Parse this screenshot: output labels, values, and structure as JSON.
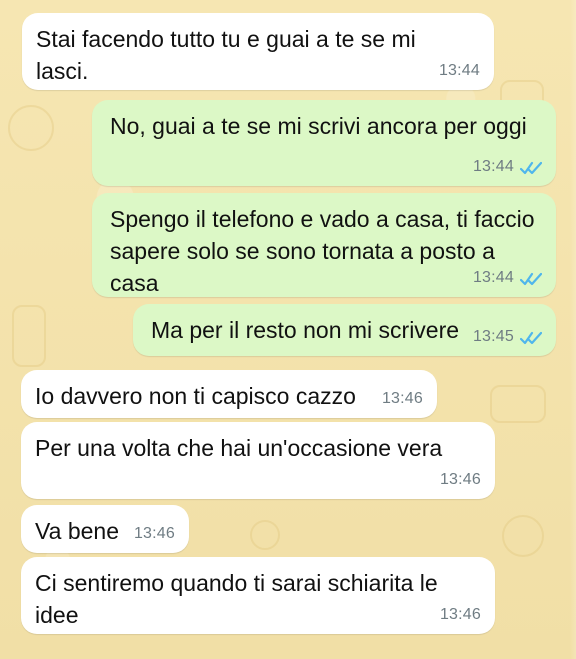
{
  "messages": [
    {
      "side": "incoming",
      "text": "Stai facendo tutto tu e guai a te se mi\nlasci.",
      "time": "13:44"
    },
    {
      "side": "outgoing",
      "text": "No, guai a te se mi scrivi ancora per oggi",
      "time": "13:44",
      "status_icon": "double-check-icon"
    },
    {
      "side": "outgoing",
      "text": "Spengo il telefono e vado a casa, ti faccio\nsapere solo se sono tornata a posto a\ncasa",
      "time": "13:44",
      "status_icon": "double-check-icon"
    },
    {
      "side": "outgoing",
      "text": "Ma per il resto non mi scrivere",
      "time": "13:45",
      "status_icon": "double-check-icon"
    },
    {
      "side": "incoming",
      "text": "Io davvero non ti capisco cazzo",
      "time": "13:46"
    },
    {
      "side": "incoming",
      "text": "Per una volta che hai un'occasione vera",
      "time": "13:46"
    },
    {
      "side": "incoming",
      "text": "Va bene",
      "time": "13:46"
    },
    {
      "side": "incoming",
      "text": "Ci sentiremo quando ti sarai schiarita le\nidee",
      "time": "13:46"
    }
  ],
  "theme": {
    "background": "#f3e3ad",
    "incoming_bubble": "#ffffff",
    "outgoing_bubble": "#dcf8c6",
    "read_tick": "#4fb6ec",
    "timestamp_color": "#6f7c83"
  }
}
